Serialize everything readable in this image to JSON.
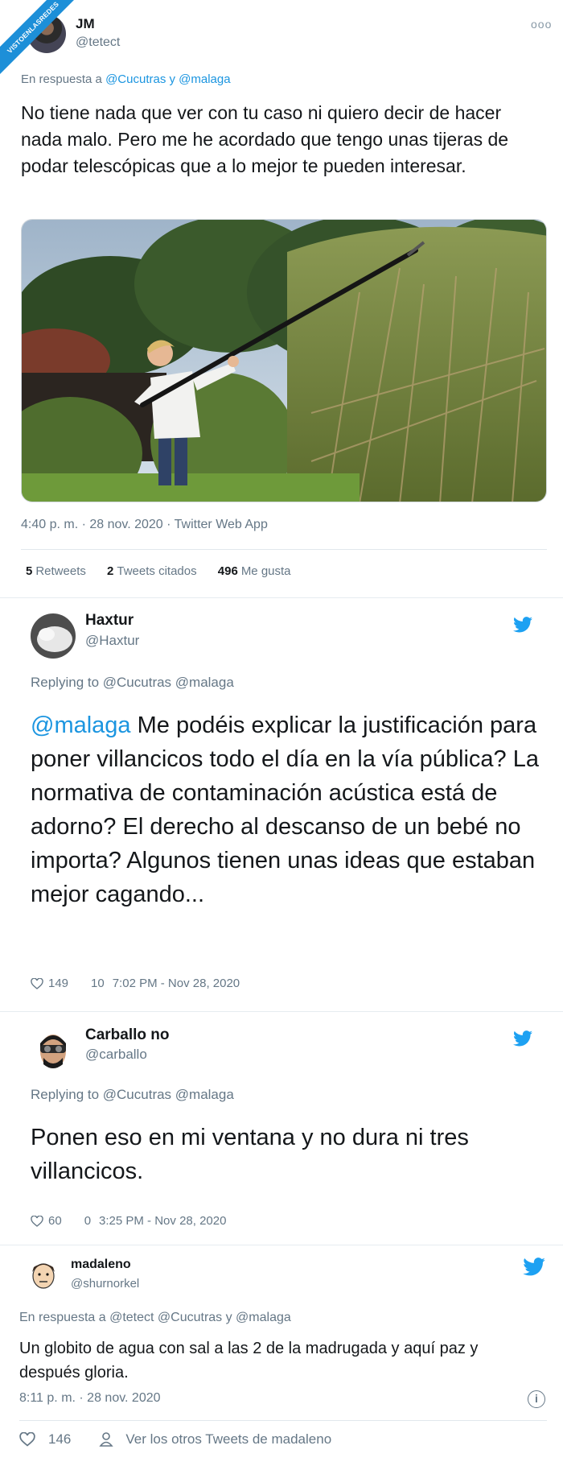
{
  "watermark": "VISTOENLASREDES",
  "tweet1": {
    "name": "JM",
    "handle": "@tetect",
    "more": "ooo",
    "reply_prefix": "En respuesta a ",
    "reply_mentions": "@Cucutras y @malaga",
    "text": "No tiene nada que ver con tu caso ni quiero decir de hacer nada malo. Pero me he acordado que tengo unas tijeras de podar telescópicas que a lo mejor te pueden interesar.",
    "timestamp": "4:40 p. m. · 28 nov. 2020 · Twitter Web App",
    "retweets_count": "5",
    "retweets_label": "Retweets",
    "quotes_count": "2",
    "quotes_label": "Tweets citados",
    "likes_count": "496",
    "likes_label": "Me gusta"
  },
  "reply1": {
    "name": "Haxtur",
    "handle": "@Haxtur",
    "replying_to": "Replying to @Cucutras @malaga",
    "mention": "@malaga",
    "text": " Me podéis explicar la justificación para poner villancicos todo el día en la vía pública? La normativa de contaminación acústica está de adorno? El derecho al descanso de un bebé no importa? Algunos tienen unas ideas que estaban mejor cagando...",
    "likes": "149",
    "retweets": "10",
    "timestamp": "7:02 PM - Nov 28, 2020"
  },
  "reply2": {
    "name": "Carballo no",
    "handle": "@carballo",
    "replying_to": "Replying to @Cucutras @malaga",
    "text": "Ponen eso en mi ventana y no dura ni tres villancicos.",
    "likes": "60",
    "retweets": "0",
    "timestamp": "3:25 PM - Nov 28, 2020"
  },
  "reply3": {
    "name": "madaleno",
    "handle": "@shurnorkel",
    "reply_prefix": "En respuesta a ",
    "reply_mentions": "@tetect @Cucutras y @malaga",
    "text": "Un globito de agua con sal a las 2 de la madrugada y aquí paz y después gloria.",
    "timestamp": "8:11 p. m. · 28 nov. 2020",
    "info": "i",
    "likes": "146",
    "see_more": "Ver los otros Tweets de madaleno"
  },
  "colors": {
    "link": "#1b95e0",
    "muted": "#657786",
    "twitter_blue": "#1da1f2"
  }
}
